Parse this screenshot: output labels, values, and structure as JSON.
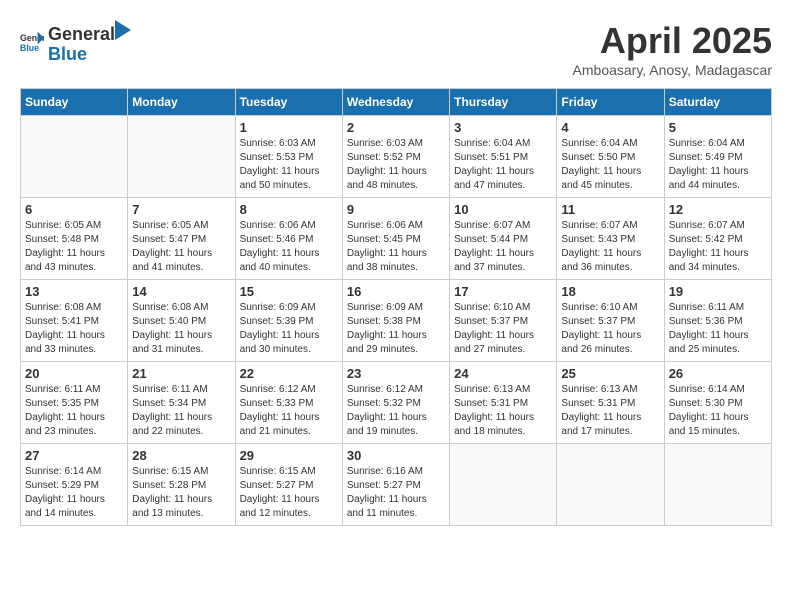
{
  "header": {
    "logo_general": "General",
    "logo_blue": "Blue",
    "month_title": "April 2025",
    "subtitle": "Amboasary, Anosy, Madagascar"
  },
  "calendar": {
    "days_of_week": [
      "Sunday",
      "Monday",
      "Tuesday",
      "Wednesday",
      "Thursday",
      "Friday",
      "Saturday"
    ],
    "weeks": [
      [
        {
          "day": "",
          "info": ""
        },
        {
          "day": "",
          "info": ""
        },
        {
          "day": "1",
          "info": "Sunrise: 6:03 AM\nSunset: 5:53 PM\nDaylight: 11 hours and 50 minutes."
        },
        {
          "day": "2",
          "info": "Sunrise: 6:03 AM\nSunset: 5:52 PM\nDaylight: 11 hours and 48 minutes."
        },
        {
          "day": "3",
          "info": "Sunrise: 6:04 AM\nSunset: 5:51 PM\nDaylight: 11 hours and 47 minutes."
        },
        {
          "day": "4",
          "info": "Sunrise: 6:04 AM\nSunset: 5:50 PM\nDaylight: 11 hours and 45 minutes."
        },
        {
          "day": "5",
          "info": "Sunrise: 6:04 AM\nSunset: 5:49 PM\nDaylight: 11 hours and 44 minutes."
        }
      ],
      [
        {
          "day": "6",
          "info": "Sunrise: 6:05 AM\nSunset: 5:48 PM\nDaylight: 11 hours and 43 minutes."
        },
        {
          "day": "7",
          "info": "Sunrise: 6:05 AM\nSunset: 5:47 PM\nDaylight: 11 hours and 41 minutes."
        },
        {
          "day": "8",
          "info": "Sunrise: 6:06 AM\nSunset: 5:46 PM\nDaylight: 11 hours and 40 minutes."
        },
        {
          "day": "9",
          "info": "Sunrise: 6:06 AM\nSunset: 5:45 PM\nDaylight: 11 hours and 38 minutes."
        },
        {
          "day": "10",
          "info": "Sunrise: 6:07 AM\nSunset: 5:44 PM\nDaylight: 11 hours and 37 minutes."
        },
        {
          "day": "11",
          "info": "Sunrise: 6:07 AM\nSunset: 5:43 PM\nDaylight: 11 hours and 36 minutes."
        },
        {
          "day": "12",
          "info": "Sunrise: 6:07 AM\nSunset: 5:42 PM\nDaylight: 11 hours and 34 minutes."
        }
      ],
      [
        {
          "day": "13",
          "info": "Sunrise: 6:08 AM\nSunset: 5:41 PM\nDaylight: 11 hours and 33 minutes."
        },
        {
          "day": "14",
          "info": "Sunrise: 6:08 AM\nSunset: 5:40 PM\nDaylight: 11 hours and 31 minutes."
        },
        {
          "day": "15",
          "info": "Sunrise: 6:09 AM\nSunset: 5:39 PM\nDaylight: 11 hours and 30 minutes."
        },
        {
          "day": "16",
          "info": "Sunrise: 6:09 AM\nSunset: 5:38 PM\nDaylight: 11 hours and 29 minutes."
        },
        {
          "day": "17",
          "info": "Sunrise: 6:10 AM\nSunset: 5:37 PM\nDaylight: 11 hours and 27 minutes."
        },
        {
          "day": "18",
          "info": "Sunrise: 6:10 AM\nSunset: 5:37 PM\nDaylight: 11 hours and 26 minutes."
        },
        {
          "day": "19",
          "info": "Sunrise: 6:11 AM\nSunset: 5:36 PM\nDaylight: 11 hours and 25 minutes."
        }
      ],
      [
        {
          "day": "20",
          "info": "Sunrise: 6:11 AM\nSunset: 5:35 PM\nDaylight: 11 hours and 23 minutes."
        },
        {
          "day": "21",
          "info": "Sunrise: 6:11 AM\nSunset: 5:34 PM\nDaylight: 11 hours and 22 minutes."
        },
        {
          "day": "22",
          "info": "Sunrise: 6:12 AM\nSunset: 5:33 PM\nDaylight: 11 hours and 21 minutes."
        },
        {
          "day": "23",
          "info": "Sunrise: 6:12 AM\nSunset: 5:32 PM\nDaylight: 11 hours and 19 minutes."
        },
        {
          "day": "24",
          "info": "Sunrise: 6:13 AM\nSunset: 5:31 PM\nDaylight: 11 hours and 18 minutes."
        },
        {
          "day": "25",
          "info": "Sunrise: 6:13 AM\nSunset: 5:31 PM\nDaylight: 11 hours and 17 minutes."
        },
        {
          "day": "26",
          "info": "Sunrise: 6:14 AM\nSunset: 5:30 PM\nDaylight: 11 hours and 15 minutes."
        }
      ],
      [
        {
          "day": "27",
          "info": "Sunrise: 6:14 AM\nSunset: 5:29 PM\nDaylight: 11 hours and 14 minutes."
        },
        {
          "day": "28",
          "info": "Sunrise: 6:15 AM\nSunset: 5:28 PM\nDaylight: 11 hours and 13 minutes."
        },
        {
          "day": "29",
          "info": "Sunrise: 6:15 AM\nSunset: 5:27 PM\nDaylight: 11 hours and 12 minutes."
        },
        {
          "day": "30",
          "info": "Sunrise: 6:16 AM\nSunset: 5:27 PM\nDaylight: 11 hours and 11 minutes."
        },
        {
          "day": "",
          "info": ""
        },
        {
          "day": "",
          "info": ""
        },
        {
          "day": "",
          "info": ""
        }
      ]
    ]
  }
}
